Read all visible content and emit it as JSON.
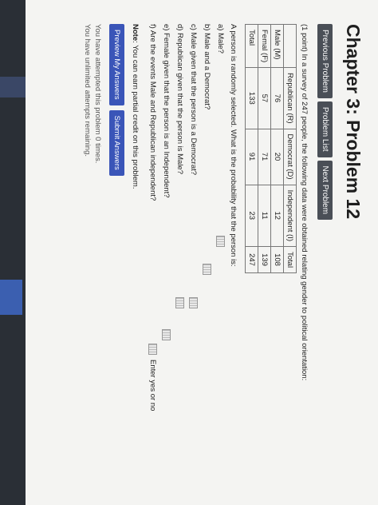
{
  "page": {
    "title": "Chapter 3: Problem 12"
  },
  "nav": {
    "previous": "Previous Problem",
    "list": "Problem List",
    "next": "Next Problem"
  },
  "problem": {
    "intro": "(1 point) In a survey of 247 people, the following data were obtained relating gender to political orientation:",
    "table": {
      "headers": [
        "",
        "Republican (R)",
        "Democrat (D)",
        "Independent (I)",
        "Total"
      ],
      "rows": [
        [
          "Male (M)",
          "76",
          "20",
          "12",
          "108"
        ],
        [
          "Femal (F)",
          "57",
          "71",
          "11",
          "139"
        ],
        [
          "Total",
          "133",
          "91",
          "23",
          "247"
        ]
      ]
    },
    "prompt": "A person is randomly selected. What is the probability that the person is:",
    "questions": [
      {
        "label": "a) Male?"
      },
      {
        "label": "b) Male and a Democrat?"
      },
      {
        "label": "c) Male given that the person is a Democrat?"
      },
      {
        "label": "d) Republican given that the person is Male?"
      },
      {
        "label": "e) Female given that the person is an Independent?"
      },
      {
        "label": "f) Are the events Male and Republican independent?"
      }
    ],
    "hint": "Enter yes or no"
  },
  "note": {
    "label": "Note",
    "text": ": You can earn partial credit on this problem."
  },
  "actions": {
    "preview": "Preview My Answers",
    "submit": "Submit Answers"
  },
  "status": {
    "attempts": "You have attempted this problem 0 times.",
    "remaining": "You have unlimited attempts remaining."
  },
  "colors": {
    "nav_button": "#4a4f57",
    "action_button": "#3a55b8",
    "page_background": "#f4f4f2"
  }
}
